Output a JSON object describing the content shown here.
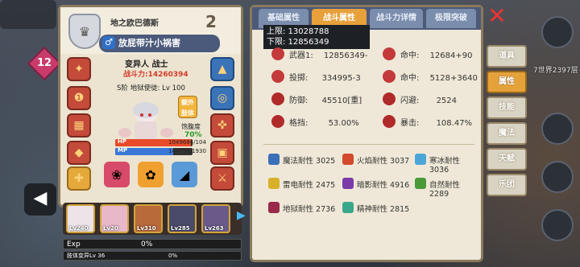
{
  "background": {
    "world_label": "7世界2397层",
    "level_badge": "12"
  },
  "character": {
    "name": "地之欧巴德斯",
    "title": "放屁带汁小祸害",
    "number": "2",
    "class": "变异人 战士",
    "power": "战斗力:14260394",
    "rank": "S阶 地狱使徒: Lv 100",
    "extra_button": "额外肢体",
    "hunger_label": "饱腹度",
    "hunger_value": "70%",
    "hp_label": "HP",
    "hp_value": "1049684/104",
    "hp_fraction": 0.98,
    "mp_label": "MP",
    "mp_value": "144756/1930",
    "mp_fraction": 0.75
  },
  "team": [
    {
      "level": "Lv240"
    },
    {
      "level": "Lv20"
    },
    {
      "level": "Lv310"
    },
    {
      "level": "Lv285"
    },
    {
      "level": "Lv263"
    }
  ],
  "exp": {
    "label": "Exp",
    "value": "0%",
    "fraction": 0
  },
  "limb": {
    "label": "肢体变异Lv 36",
    "value": "0%",
    "fraction": 0
  },
  "tabs": [
    {
      "label": "基础属性",
      "active": false
    },
    {
      "label": "战斗属性",
      "active": true
    },
    {
      "label": "战斗力详情",
      "active": false
    },
    {
      "label": "极限突破",
      "active": false
    }
  ],
  "limits": {
    "upper": "上限: 13028788",
    "lower": "下限: 12856349"
  },
  "stats": [
    {
      "label": "武器1:",
      "value": "12856349-",
      "icon": "sword-icon",
      "color": "#c43a3a"
    },
    {
      "label": "命中:",
      "value": "12684+90",
      "icon": "target-icon",
      "color": "#c43a3a"
    },
    {
      "label": "投掷:",
      "value": "334995-3",
      "icon": "throw-icon",
      "color": "#c43a3a"
    },
    {
      "label": "命中:",
      "value": "5128+3640",
      "icon": "target-icon",
      "color": "#c43a3a"
    },
    {
      "label": "防御:",
      "value": "45510[重]",
      "icon": "shield-icon",
      "color": "#b02a2a"
    },
    {
      "label": "闪避:",
      "value": "2524",
      "icon": "dodge-icon",
      "color": "#b02a2a"
    },
    {
      "label": "格挡:",
      "value": "53.00%",
      "icon": "block-icon",
      "color": "#b02a2a"
    },
    {
      "label": "暴击:",
      "value": "108.47%",
      "icon": "crit-icon",
      "color": "#b02a2a"
    }
  ],
  "resistances": [
    {
      "label": "魔法耐性 3025",
      "icon": "magic-icon",
      "color": "#3b6fb8"
    },
    {
      "label": "火焰耐性 3037",
      "icon": "fire-icon",
      "color": "#d24a2a"
    },
    {
      "label": "寒冰耐性 3036",
      "icon": "ice-icon",
      "color": "#4aa6d8"
    },
    {
      "label": "雷电耐性 2475",
      "icon": "lightning-icon",
      "color": "#d8b02a"
    },
    {
      "label": "暗影耐性 4916",
      "icon": "shadow-icon",
      "color": "#7a3aa8"
    },
    {
      "label": "自然耐性 2289",
      "icon": "nature-icon",
      "color": "#4a9a3a"
    },
    {
      "label": "地狱耐性 2736",
      "icon": "hell-icon",
      "color": "#9a2a4a"
    },
    {
      "label": "精神耐性 2815",
      "icon": "spirit-icon",
      "color": "#3aa88a"
    }
  ],
  "side_menu": [
    {
      "label": "道具",
      "active": false
    },
    {
      "label": "属性",
      "active": true
    },
    {
      "label": "技能",
      "active": false
    },
    {
      "label": "魔法",
      "active": false
    },
    {
      "label": "天赋",
      "active": false
    },
    {
      "label": "乐团",
      "active": false
    }
  ],
  "close_icon": "close-icon"
}
